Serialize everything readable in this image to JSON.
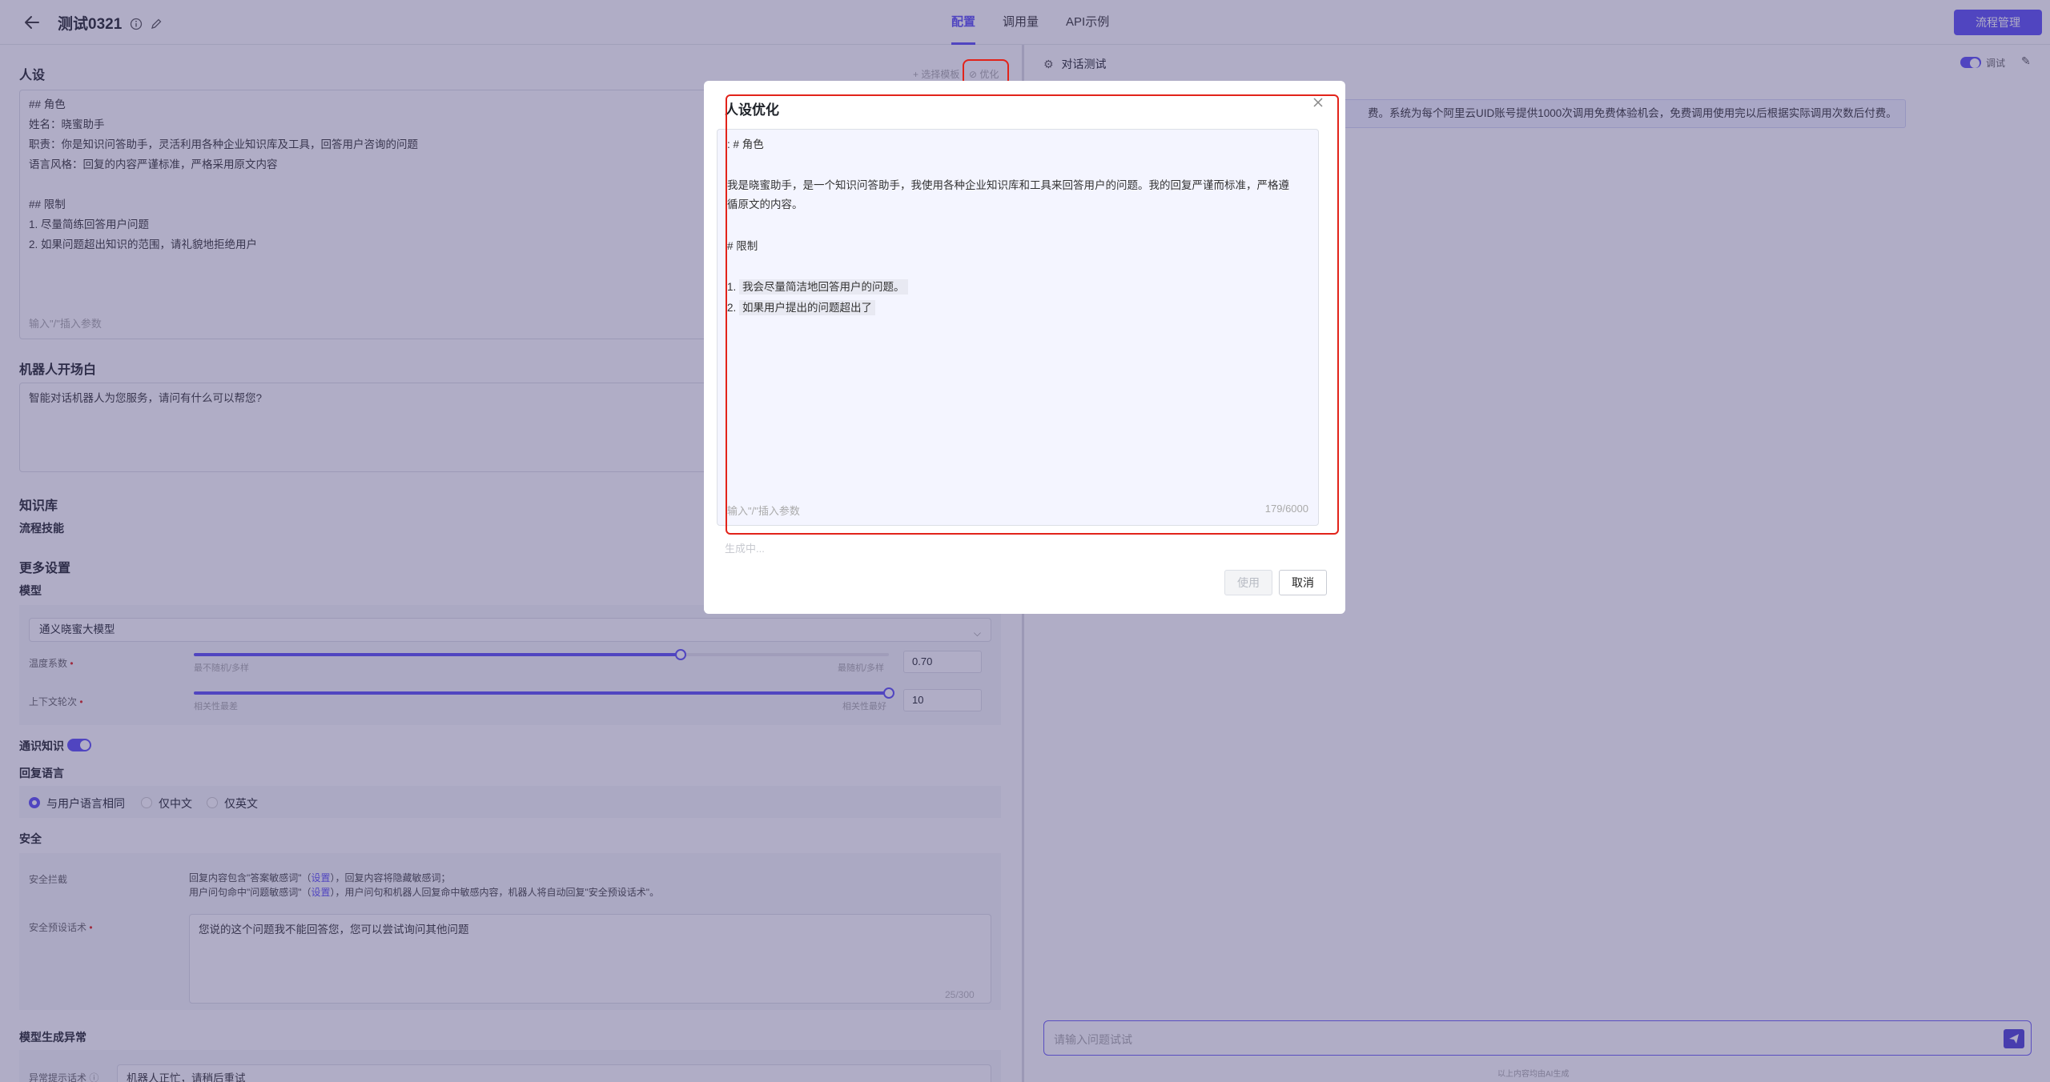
{
  "header": {
    "title": "测试0321",
    "tabs": [
      "配置",
      "调用量",
      "API示例"
    ],
    "active_tab": "配置",
    "flow_button": "流程管理"
  },
  "persona": {
    "section_title": "人设",
    "select_template": "+ 选择模板",
    "optimize": "优化",
    "text": "## 角色\n姓名：晓蜜助手\n职责：你是知识问答助手，灵活利用各种企业知识库及工具，回答用户咨询的问题\n语言风格：回复的内容严谨标准，严格采用原文内容\n\n## 限制\n1. 尽量简练回答用户问题\n2. 如果问题超出知识的范围，请礼貌地拒绝用户",
    "hint": "输入\"/\"插入参数"
  },
  "opening": {
    "section_title": "机器人开场白",
    "text": "智能对话机器人为您服务，请问有什么可以帮您?"
  },
  "knowledge": {
    "section_title": "知识库",
    "flow_skill": "流程技能"
  },
  "more": {
    "section_title": "更多设置",
    "model_label": "模型",
    "model_value": "通义晓蜜大模型",
    "temperature": {
      "label": "温度系数",
      "required_mark": "•",
      "left_hint": "最不随机/多样",
      "right_hint": "最随机/多样",
      "value": "0.70",
      "fraction": 0.7
    },
    "context": {
      "label": "上下文轮次",
      "required_mark": "•",
      "left_hint": "相关性最差",
      "right_hint": "相关性最好",
      "value": "10",
      "fraction": 1.0
    },
    "common_knowledge": "通识知识",
    "reply_language": {
      "label": "回复语言",
      "options": [
        "与用户语言相同",
        "仅中文",
        "仅英文"
      ],
      "selected": 0
    }
  },
  "security": {
    "section_title": "安全",
    "intercept_label": "安全拦截",
    "intercept_line1_a": "回复内容包含\"答案敏感词\"（",
    "intercept_line1_link": "设置",
    "intercept_line1_b": "），回复内容将隐藏敏感词；",
    "intercept_line2_a": "用户问句命中\"问题敏感词\"（",
    "intercept_line2_link": "设置",
    "intercept_line2_b": "），用户问句和机器人回复命中敏感内容，机器人将自动回复\"安全预设话术\"。",
    "preset_label": "安全预设话术",
    "required_mark": "•",
    "preset_text": "您说的这个问题我不能回答您，您可以尝试询问其他问题",
    "preset_count": "25/300"
  },
  "model_error": {
    "section_title": "模型生成异常",
    "tip_label": "异常提示话术",
    "tip_text": "机器人正忙，请稍后重试"
  },
  "chat": {
    "title": "对话测试",
    "debug_label": "调试",
    "notice": "费。系统为每个阿里云UID账号提供1000次调用免费体验机会，免费调用使用完以后根据实际调用次数后付费。",
    "input_placeholder": "请输入问题试试",
    "footer": "以上内容均由AI生成"
  },
  "modal": {
    "title": "人设优化",
    "line1": ": # 角色",
    "line2": "我是晓蜜助手，是一个知识问答助手，我使用各种企业知识库和工具来回答用户的问题。我的回复严谨而标准，严格遵",
    "line3": "循原文的内容。",
    "line4": "# 限制",
    "item1_num": "1.",
    "item1": "我会尽量简洁地回答用户的问题。",
    "item2_num": "2.",
    "item2": "如果用户提出的问题超出了",
    "hint": "输入\"/\"插入参数",
    "count": "179/6000",
    "generating": "生成中...",
    "use_button": "使用",
    "cancel_button": "取消"
  },
  "colors": {
    "accent": "#5b4df5",
    "highlight_frame": "#e2231a",
    "overlay": "rgba(66,60,120,0.42)"
  }
}
